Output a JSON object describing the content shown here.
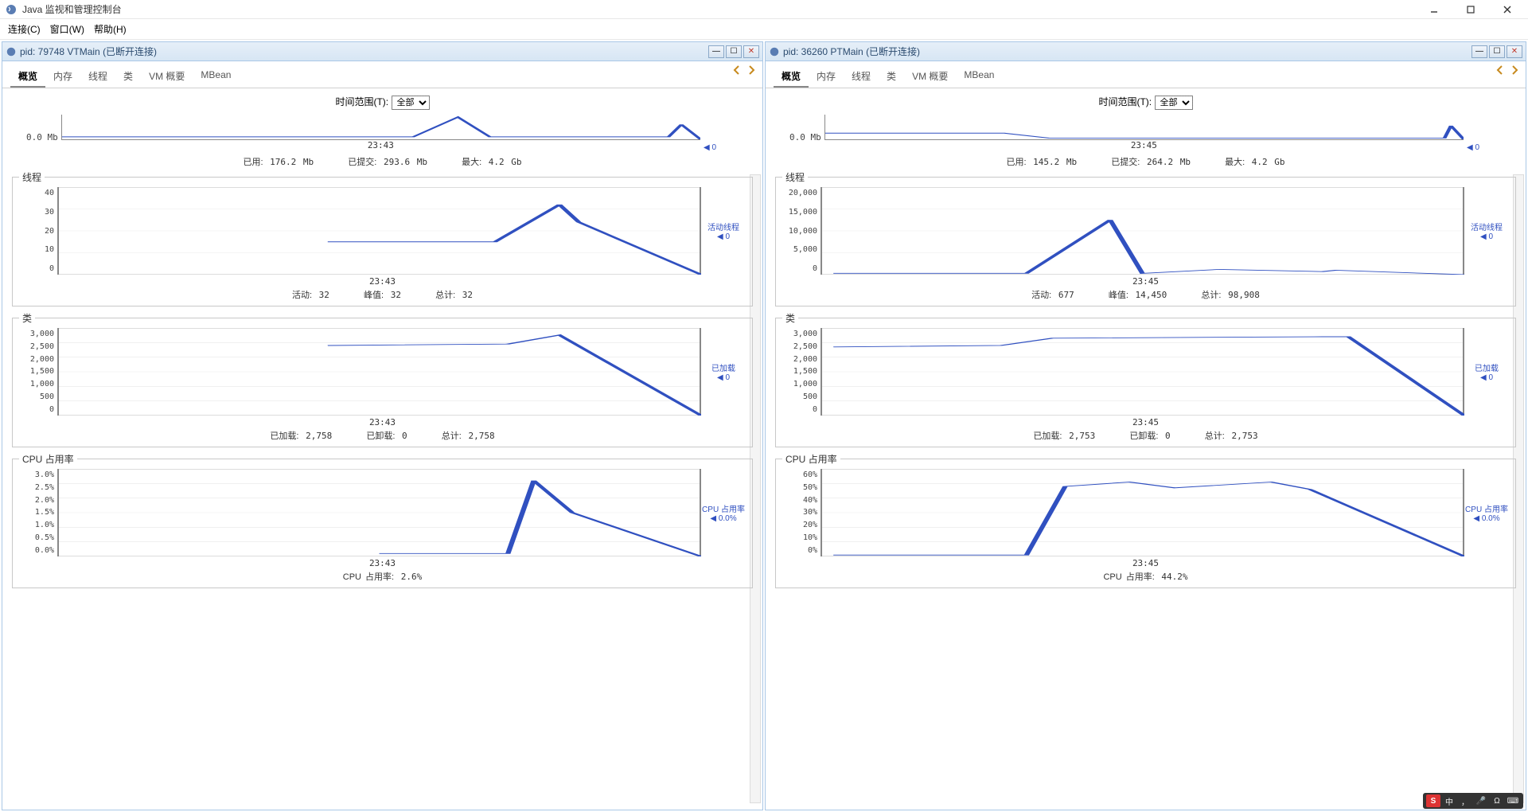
{
  "app": {
    "title": "Java 监视和管理控制台",
    "menubar": [
      "连接(C)",
      "窗口(W)",
      "帮助(H)"
    ]
  },
  "windows": [
    {
      "title": "pid: 79748 VTMain (已断开连接)",
      "tabs": [
        "概览",
        "内存",
        "线程",
        "类",
        "VM 概要",
        "MBean"
      ],
      "active_tab": 0,
      "time_range": {
        "label": "时间范围(T):",
        "value": "全部"
      },
      "heap_mini": {
        "ylabel": "0.0 Mb",
        "xticks": "23:43",
        "legend_val": "0"
      },
      "heap_stats": {
        "used_label": "已用:",
        "used": "176.2 Mb",
        "committed_label": "已提交:",
        "committed": "293.6 Mb",
        "max_label": "最大:",
        "max": "4.2 Gb"
      },
      "threads": {
        "title": "线程",
        "yticks": [
          "40",
          "30",
          "20",
          "10",
          "0"
        ],
        "xticks": "23:43",
        "legend": "活动线程",
        "legend_val": "0",
        "stats": {
          "live_label": "活动:",
          "live": "32",
          "peak_label": "峰值:",
          "peak": "32",
          "total_label": "总计:",
          "total": "32"
        }
      },
      "classes": {
        "title": "类",
        "yticks": [
          "3,000",
          "2,500",
          "2,000",
          "1,500",
          "1,000",
          "500",
          "0"
        ],
        "xticks": "23:43",
        "legend": "已加载",
        "legend_val": "0",
        "stats": {
          "loaded_label": "已加载:",
          "loaded": "2,758",
          "unloaded_label": "已卸载:",
          "unloaded": "0",
          "total_label": "总计:",
          "total": "2,758"
        }
      },
      "cpu": {
        "title": "CPU 占用率",
        "yticks": [
          "3.0%",
          "2.5%",
          "2.0%",
          "1.5%",
          "1.0%",
          "0.5%",
          "0.0%"
        ],
        "xticks": "23:43",
        "legend": "CPU 占用率",
        "legend_val": "0.0%",
        "stats": {
          "label": "CPU 占用率:",
          "val": "2.6%"
        }
      }
    },
    {
      "title": "pid: 36260 PTMain (已断开连接)",
      "tabs": [
        "概览",
        "内存",
        "线程",
        "类",
        "VM 概要",
        "MBean"
      ],
      "active_tab": 0,
      "time_range": {
        "label": "时间范围(T):",
        "value": "全部"
      },
      "heap_mini": {
        "ylabel": "0.0 Mb",
        "xticks": "23:45",
        "legend_val": "0"
      },
      "heap_stats": {
        "used_label": "已用:",
        "used": "145.2 Mb",
        "committed_label": "已提交:",
        "committed": "264.2 Mb",
        "max_label": "最大:",
        "max": "4.2 Gb"
      },
      "threads": {
        "title": "线程",
        "yticks": [
          "20,000",
          "15,000",
          "10,000",
          "5,000",
          "0"
        ],
        "xticks": "23:45",
        "legend": "活动线程",
        "legend_val": "0",
        "stats": {
          "live_label": "活动:",
          "live": "677",
          "peak_label": "峰值:",
          "peak": "14,450",
          "total_label": "总计:",
          "total": "98,908"
        }
      },
      "classes": {
        "title": "类",
        "yticks": [
          "3,000",
          "2,500",
          "2,000",
          "1,500",
          "1,000",
          "500",
          "0"
        ],
        "xticks": "23:45",
        "legend": "已加载",
        "legend_val": "0",
        "stats": {
          "loaded_label": "已加载:",
          "loaded": "2,753",
          "unloaded_label": "已卸载:",
          "unloaded": "0",
          "total_label": "总计:",
          "total": "2,753"
        }
      },
      "cpu": {
        "title": "CPU 占用率",
        "yticks": [
          "60%",
          "50%",
          "40%",
          "30%",
          "20%",
          "10%",
          "0%"
        ],
        "xticks": "23:45",
        "legend": "CPU 占用率",
        "legend_val": "0.0%",
        "stats": {
          "label": "CPU 占用率:",
          "val": "44.2%"
        }
      }
    }
  ],
  "chart_data": [
    {
      "owner": "pid-79748",
      "panel": "heap-mini",
      "type": "line",
      "xlabel": "",
      "ylabel": "Mb",
      "ylim": [
        0,
        1
      ],
      "x_tick_labels": [
        "23:43"
      ],
      "series": [
        {
          "name": "heap",
          "points": [
            [
              0.0,
              0.1
            ],
            [
              0.55,
              0.1
            ],
            [
              0.62,
              0.9
            ],
            [
              0.67,
              0.1
            ],
            [
              0.95,
              0.1
            ],
            [
              0.97,
              0.6
            ],
            [
              1.0,
              0.0
            ]
          ]
        }
      ]
    },
    {
      "owner": "pid-79748",
      "panel": "threads",
      "type": "line",
      "xlabel": "",
      "ylabel": "",
      "ylim": [
        0,
        40
      ],
      "x_tick_labels": [
        "23:43"
      ],
      "series": [
        {
          "name": "活动线程",
          "points_x_rel": [
            0.42,
            0.68,
            0.78,
            0.81,
            1.0
          ],
          "values": [
            15,
            15,
            32,
            24,
            0
          ]
        }
      ]
    },
    {
      "owner": "pid-79748",
      "panel": "classes",
      "type": "line",
      "xlabel": "",
      "ylabel": "",
      "ylim": [
        0,
        3000
      ],
      "x_tick_labels": [
        "23:43"
      ],
      "series": [
        {
          "name": "已加载",
          "points_x_rel": [
            0.42,
            0.7,
            0.78,
            1.0
          ],
          "values": [
            2400,
            2450,
            2758,
            0
          ]
        }
      ]
    },
    {
      "owner": "pid-79748",
      "panel": "cpu",
      "type": "line",
      "xlabel": "",
      "ylabel": "%",
      "ylim": [
        0,
        3.0
      ],
      "x_tick_labels": [
        "23:43"
      ],
      "series": [
        {
          "name": "CPU 占用率",
          "points_x_rel": [
            0.5,
            0.7,
            0.74,
            0.8,
            1.0
          ],
          "values": [
            0.1,
            0.1,
            2.6,
            1.5,
            0.0
          ]
        }
      ]
    },
    {
      "owner": "pid-36260",
      "panel": "heap-mini",
      "type": "line",
      "xlabel": "",
      "ylabel": "Mb",
      "ylim": [
        0,
        1
      ],
      "x_tick_labels": [
        "23:45"
      ],
      "series": [
        {
          "name": "heap",
          "points": [
            [
              0.0,
              0.25
            ],
            [
              0.28,
              0.25
            ],
            [
              0.35,
              0.05
            ],
            [
              0.97,
              0.05
            ],
            [
              0.98,
              0.55
            ],
            [
              1.0,
              0.0
            ]
          ]
        }
      ]
    },
    {
      "owner": "pid-36260",
      "panel": "threads",
      "type": "line",
      "xlabel": "",
      "ylabel": "",
      "ylim": [
        0,
        20000
      ],
      "x_tick_labels": [
        "23:45"
      ],
      "series": [
        {
          "name": "活动线程",
          "points_x_rel": [
            0.02,
            0.32,
            0.45,
            0.5,
            0.62,
            0.78,
            0.8,
            1.0
          ],
          "values": [
            300,
            300,
            12500,
            300,
            1200,
            700,
            1000,
            0
          ]
        }
      ]
    },
    {
      "owner": "pid-36260",
      "panel": "classes",
      "type": "line",
      "xlabel": "",
      "ylabel": "",
      "ylim": [
        0,
        3000
      ],
      "x_tick_labels": [
        "23:45"
      ],
      "series": [
        {
          "name": "已加载",
          "points_x_rel": [
            0.02,
            0.28,
            0.36,
            0.78,
            0.82,
            1.0
          ],
          "values": [
            2350,
            2400,
            2650,
            2700,
            2700,
            0
          ]
        }
      ]
    },
    {
      "owner": "pid-36260",
      "panel": "cpu",
      "type": "line",
      "xlabel": "",
      "ylabel": "%",
      "ylim": [
        0,
        60
      ],
      "x_tick_labels": [
        "23:45"
      ],
      "series": [
        {
          "name": "CPU 占用率",
          "points_x_rel": [
            0.02,
            0.32,
            0.38,
            0.48,
            0.55,
            0.7,
            0.76,
            1.0
          ],
          "values": [
            1,
            1,
            48,
            51,
            47,
            51,
            46,
            0
          ]
        }
      ]
    }
  ],
  "ime": {
    "sogou": "S",
    "lang": "中",
    "items": [
      "，",
      "🎤",
      "Ω",
      "⌨"
    ]
  }
}
